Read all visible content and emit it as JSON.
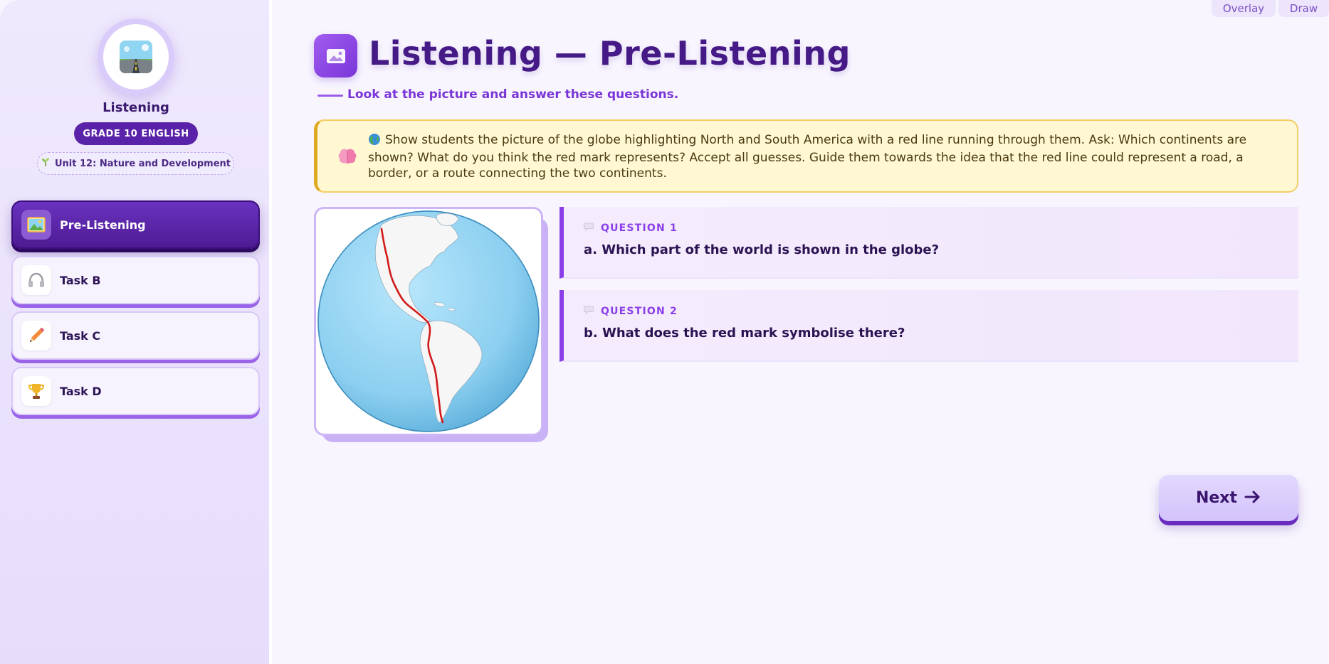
{
  "sidebar": {
    "logo_icon": "road-icon",
    "title": "Listening",
    "grade": "GRADE 10 ENGLISH",
    "unit_icon": "seedling-icon",
    "unit": "Unit 12: Nature and Development",
    "items": [
      {
        "label": "Pre-Listening",
        "icon": "picture-icon",
        "active": true
      },
      {
        "label": "Task B",
        "icon": "headphones-icon",
        "active": false
      },
      {
        "label": "Task C",
        "icon": "pencil-icon",
        "active": false
      },
      {
        "label": "Task D",
        "icon": "trophy-icon",
        "active": false
      }
    ]
  },
  "top_tabs": [
    "Overlay",
    "Draw"
  ],
  "header": {
    "icon": "picture-icon",
    "title": "Listening — Pre-Listening",
    "subtitle": "Look at the picture and answer these questions."
  },
  "note": {
    "icon": "brain-icon",
    "globe_icon": "globe-icon",
    "text": "Show students the picture of the globe highlighting North and South America with a red line running through them. Ask: Which continents are shown? What do you think the red mark represents? Accept all guesses. Guide them towards the idea that the red line could represent a road, a border, or a route connecting the two continents."
  },
  "image": {
    "icon": "globe-americas-image"
  },
  "questions": [
    {
      "label": "QUESTION 1",
      "text": "a. Which part of the world is shown in the globe?"
    },
    {
      "label": "QUESTION 2",
      "text": "b. What does the red mark symbolise there?"
    }
  ],
  "next_button": {
    "label": "Next",
    "icon": "arrow-right-icon"
  },
  "colors": {
    "primary": "#5a22a8",
    "accent": "#8a3ee8",
    "note_bg": "#fff8d2",
    "note_border": "#f3cf63",
    "route_red": "#d11a1a"
  }
}
